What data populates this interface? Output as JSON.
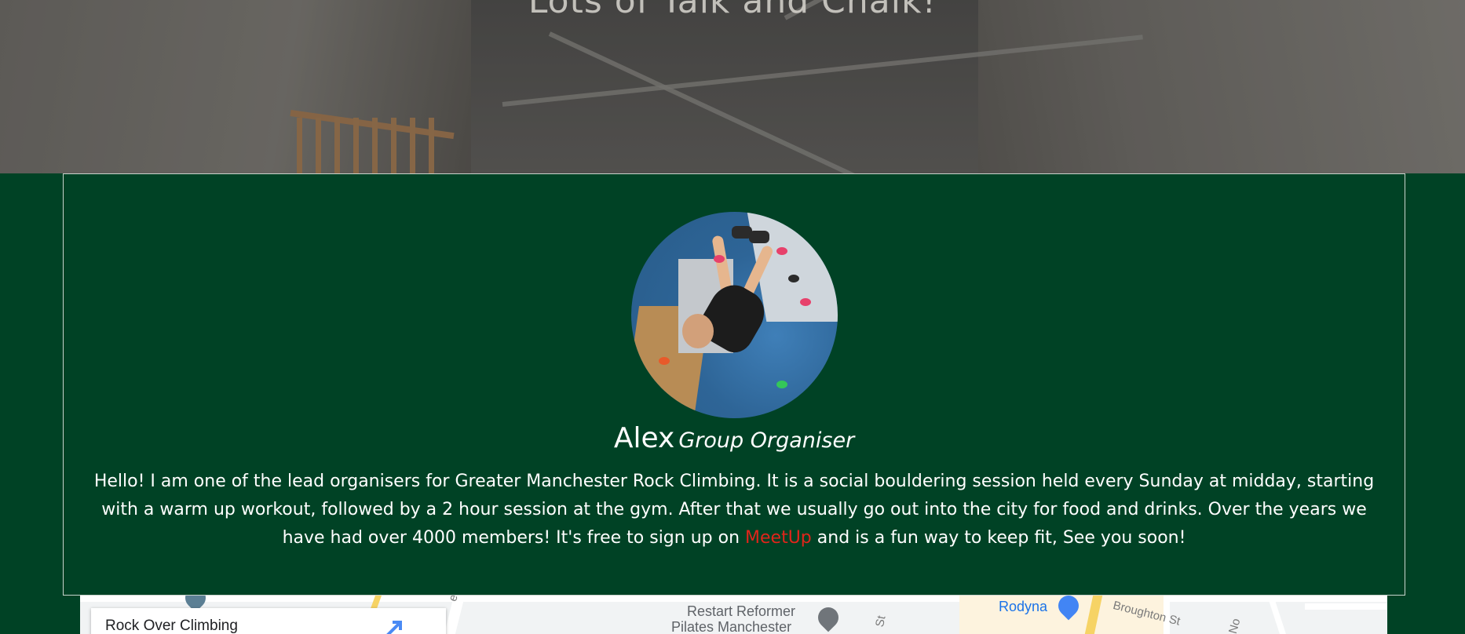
{
  "hero": {
    "title": "Lots of Talk and Chalk!"
  },
  "profile": {
    "name": "Alex",
    "role": "Group Organiser",
    "bio_before_link": "Hello! I am one of the lead organisers for Greater Manchester Rock Climbing. It is a social bouldering session held every Sunday at midday, starting with a warm up workout, followed by a 2 hour session at the gym. After that we usually go out into the city for food and drinks. Over the years we have had over 4000 members! It's free to sign up on",
    "link_text": "MeetUp",
    "bio_after_link": "and is a fun way to keep fit, See you soon!",
    "link_color": "#e1251b"
  },
  "map": {
    "place_card_title": "Rock Over Climbing",
    "poi_labels": {
      "restart_line1": "Restart Reformer",
      "restart_line2": "Pilates Manchester",
      "rodyna": "Rodyna"
    },
    "streets": {
      "broughton": "Broughton St",
      "waterloo": "erloo R",
      "st": "St",
      "no": "No"
    }
  },
  "colors": {
    "section_bg": "#004225",
    "card_border": "#c9d3cc",
    "text": "#ffffff"
  }
}
